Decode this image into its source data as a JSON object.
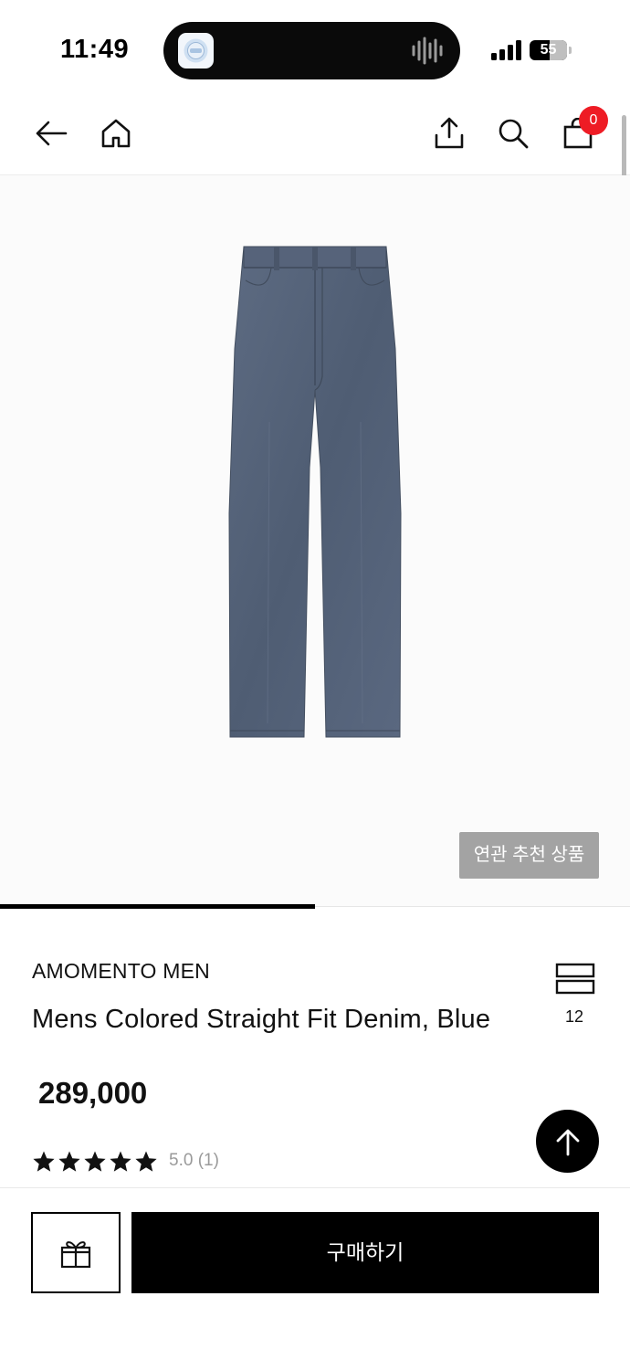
{
  "status_bar": {
    "time": "11:49",
    "battery_level": "55"
  },
  "nav": {
    "icons": [
      "back-arrow-icon",
      "home-icon",
      "share-icon",
      "search-icon",
      "shopping-bag-icon"
    ],
    "cart_count": "0"
  },
  "hero": {
    "related_button_label": "연관 추천 상품",
    "image_progress": 0.5
  },
  "product": {
    "brand": "AMOMENTO MEN",
    "name": "Mens Colored Straight Fit Denim, Blue",
    "price": "289,000",
    "rating_text": "5.0 (1)",
    "star_count": 5,
    "layout_count": "12"
  },
  "bottom_bar": {
    "buy_label": "구매하기",
    "gift_icon": "gift-icon"
  },
  "colors": {
    "accent": "#000000",
    "badge": "#ee1c25",
    "related_button": "#a3a3a3"
  }
}
